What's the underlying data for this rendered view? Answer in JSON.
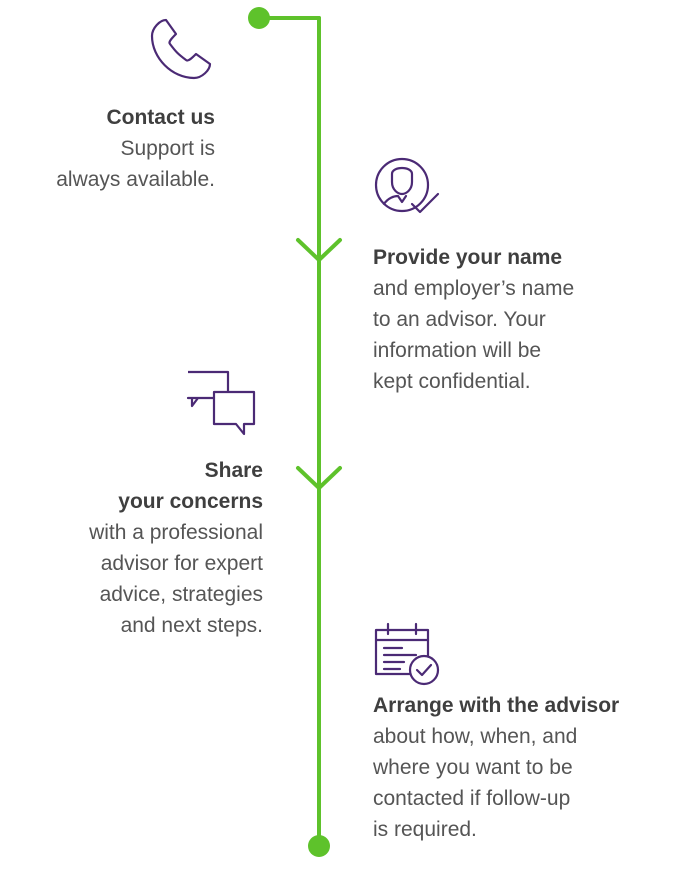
{
  "colors": {
    "accent_green": "#5ec22b",
    "icon_purple": "#4b2a75"
  },
  "steps": [
    {
      "icon": "phone-icon",
      "title": "Contact us",
      "body_lines": [
        "Support is",
        "always available."
      ]
    },
    {
      "icon": "advisor-person-icon",
      "title": "Provide your name",
      "body_lines": [
        "and employer’s name",
        "to an advisor. Your",
        "information will be",
        "kept confidential."
      ]
    },
    {
      "icon": "chat-bubbles-icon",
      "title_lines": [
        "Share",
        "your concerns"
      ],
      "body_lines": [
        "with a professional",
        "advisor for expert",
        "advice, strategies",
        "and next steps."
      ]
    },
    {
      "icon": "calendar-check-icon",
      "title": "Arrange with the advisor",
      "body_lines": [
        "about how, when, and",
        "where you want to be",
        "contacted if follow-up",
        "is required."
      ]
    }
  ]
}
